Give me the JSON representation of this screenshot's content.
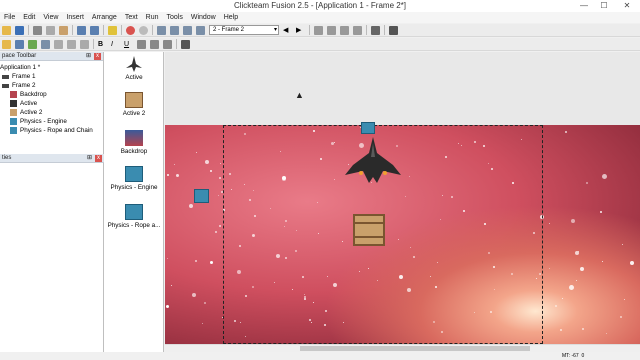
{
  "window": {
    "title": "Clickteam Fusion 2.5 - [Application 1 - Frame 2*]",
    "minimize": "—",
    "maximize": "☐",
    "close": "✕"
  },
  "menu": [
    "File",
    "Edit",
    "View",
    "Insert",
    "Arrange",
    "Text",
    "Run",
    "Tools",
    "Window",
    "Help"
  ],
  "toolbar": {
    "frame_combo": "2 - Frame 2"
  },
  "workspace": {
    "title": "pace Toolbar",
    "tree": [
      {
        "label": "Application 1 *",
        "icon": "application-icon",
        "indent": 0
      },
      {
        "label": "Frame 1",
        "icon": "frame-icon",
        "indent": 1
      },
      {
        "label": "Frame 2",
        "icon": "frame-icon",
        "indent": 1
      },
      {
        "label": "Backdrop",
        "icon": "backdrop-icon",
        "indent": 2
      },
      {
        "label": "Active",
        "icon": "active-icon",
        "indent": 2
      },
      {
        "label": "Active 2",
        "icon": "crate-icon",
        "indent": 2
      },
      {
        "label": "Physics - Engine",
        "icon": "physics-engine-icon",
        "indent": 2
      },
      {
        "label": "Physics - Rope and Chain",
        "icon": "physics-rope-icon",
        "indent": 2
      }
    ]
  },
  "properties": {
    "title": "ties"
  },
  "objects": [
    {
      "label": "Active",
      "icon": "spaceship-icon"
    },
    {
      "label": "Active 2",
      "icon": "crate-icon"
    },
    {
      "label": "Backdrop",
      "icon": "backdrop-icon"
    },
    {
      "label": "Physics - Engine",
      "icon": "physics-engine-icon"
    },
    {
      "label": "Physics - Rope a...",
      "icon": "physics-rope-icon"
    }
  ],
  "status": {
    "coords": "MT: -67",
    "zero": "0"
  },
  "colors": {
    "accent": "#d9534f",
    "scene": "#cf4f5f",
    "physics": "#3a8cb0"
  }
}
